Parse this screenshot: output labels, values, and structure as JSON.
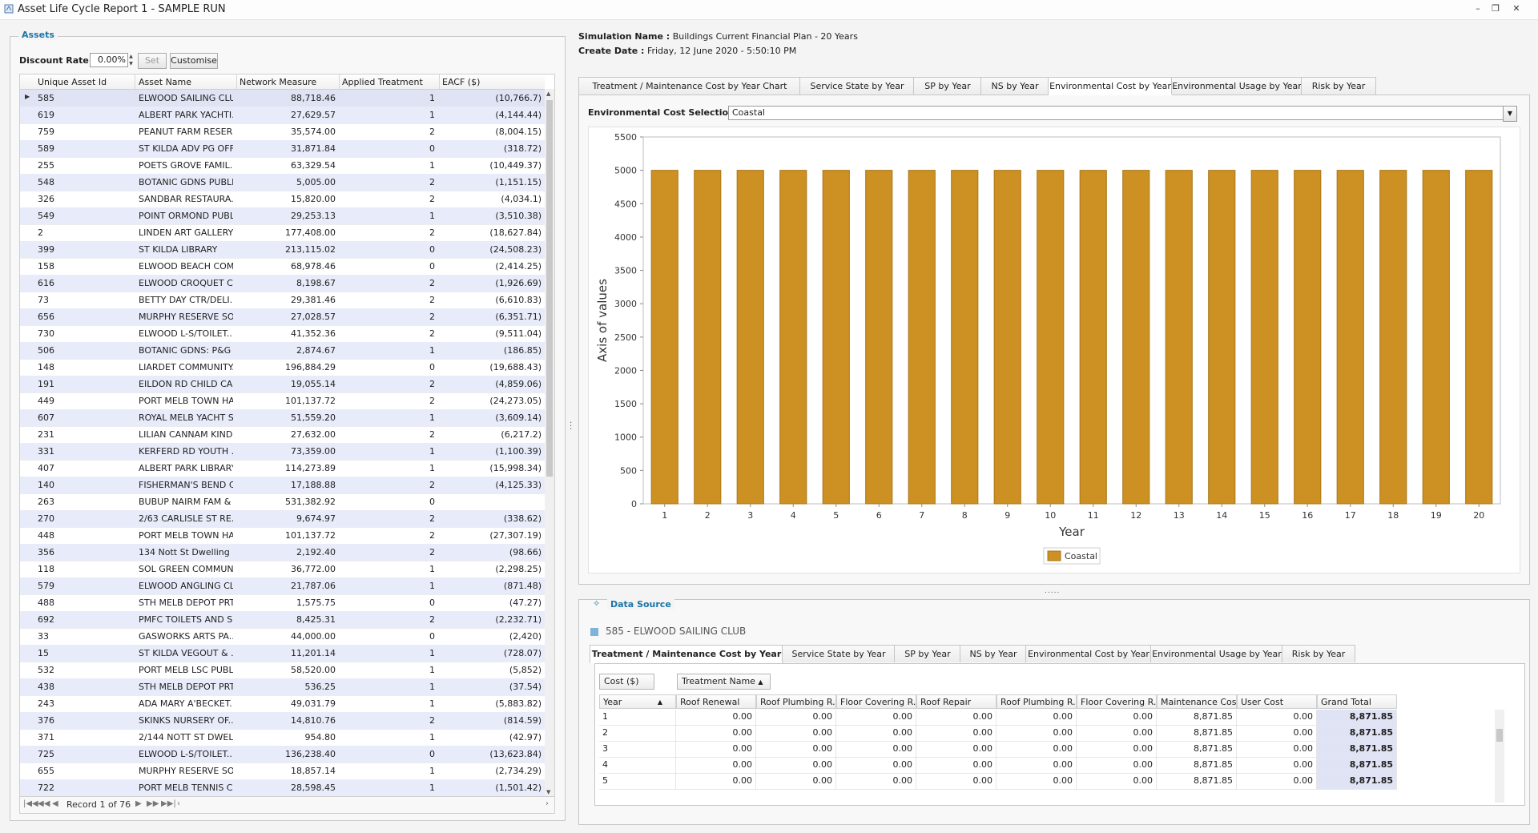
{
  "window": {
    "title": "Asset Life Cycle Report 1 - SAMPLE RUN"
  },
  "assets_panel": {
    "title": "Assets",
    "discount_label": "Discount Rate :",
    "discount_value": "0.00%",
    "set_label": "Set",
    "customise_label": "Customise",
    "columns": [
      "Unique Asset Id",
      "Asset Name",
      "Network Measure",
      "Applied Treatment",
      "EACF ($)"
    ],
    "rows": [
      [
        "585",
        "ELWOOD SAILING CLUB",
        "88,718.46",
        "1",
        "(10,766.7)"
      ],
      [
        "619",
        "ALBERT PARK YACHTI...",
        "27,629.57",
        "1",
        "(4,144.44)"
      ],
      [
        "759",
        "PEANUT FARM RESER...",
        "35,574.00",
        "2",
        "(8,004.15)"
      ],
      [
        "589",
        "ST KILDA ADV PG OFF...",
        "31,871.84",
        "0",
        "(318.72)"
      ],
      [
        "255",
        "POETS GROVE FAMIL...",
        "63,329.54",
        "1",
        "(10,449.37)"
      ],
      [
        "548",
        "BOTANIC GDNS PUBLI...",
        "5,005.00",
        "2",
        "(1,151.15)"
      ],
      [
        "326",
        "SANDBAR RESTAURA...",
        "15,820.00",
        "2",
        "(4,034.1)"
      ],
      [
        "549",
        "POINT ORMOND PUBL...",
        "29,253.13",
        "1",
        "(3,510.38)"
      ],
      [
        "2",
        "LINDEN ART GALLERY",
        "177,408.00",
        "2",
        "(18,627.84)"
      ],
      [
        "399",
        "ST KILDA LIBRARY",
        "213,115.02",
        "0",
        "(24,508.23)"
      ],
      [
        "158",
        "ELWOOD BEACH COM...",
        "68,978.46",
        "0",
        "(2,414.25)"
      ],
      [
        "616",
        "ELWOOD CROQUET C...",
        "8,198.67",
        "2",
        "(1,926.69)"
      ],
      [
        "73",
        "BETTY DAY CTR/DELI...",
        "29,381.46",
        "2",
        "(6,610.83)"
      ],
      [
        "656",
        "MURPHY RESERVE SO...",
        "27,028.57",
        "2",
        "(6,351.71)"
      ],
      [
        "730",
        "ELWOOD L-S/TOILET...",
        "41,352.36",
        "2",
        "(9,511.04)"
      ],
      [
        "506",
        "BOTANIC GDNS: P&G ...",
        "2,874.67",
        "1",
        "(186.85)"
      ],
      [
        "148",
        "LIARDET COMMUNITY...",
        "196,884.29",
        "0",
        "(19,688.43)"
      ],
      [
        "191",
        "EILDON RD CHILD CA...",
        "19,055.14",
        "2",
        "(4,859.06)"
      ],
      [
        "449",
        "PORT MELB TOWN HALL",
        "101,137.72",
        "2",
        "(24,273.05)"
      ],
      [
        "607",
        "ROYAL MELB YACHT S...",
        "51,559.20",
        "1",
        "(3,609.14)"
      ],
      [
        "231",
        "LILIAN CANNAM KIND...",
        "27,632.00",
        "2",
        "(6,217.2)"
      ],
      [
        "331",
        "KERFERD RD YOUTH ...",
        "73,359.00",
        "1",
        "(1,100.39)"
      ],
      [
        "407",
        "ALBERT PARK LIBRARY",
        "114,273.89",
        "1",
        "(15,998.34)"
      ],
      [
        "140",
        "FISHERMAN'S BEND C...",
        "17,188.88",
        "2",
        "(4,125.33)"
      ],
      [
        "263",
        "BUBUP NAIRM FAM & ...",
        "531,382.92",
        "0",
        ""
      ],
      [
        "270",
        "2/63 CARLISLE ST RE...",
        "9,674.97",
        "2",
        "(338.62)"
      ],
      [
        "448",
        "PORT MELB TOWN HALL",
        "101,137.72",
        "2",
        "(27,307.19)"
      ],
      [
        "356",
        "134 Nott St Dwelling",
        "2,192.40",
        "2",
        "(98.66)"
      ],
      [
        "118",
        "SOL GREEN COMMUN...",
        "36,772.00",
        "1",
        "(2,298.25)"
      ],
      [
        "579",
        "ELWOOD ANGLING CL...",
        "21,787.06",
        "1",
        "(871.48)"
      ],
      [
        "488",
        "STH MELB DEPOT PRT...",
        "1,575.75",
        "0",
        "(47.27)"
      ],
      [
        "692",
        "PMFC TOILETS AND S...",
        "8,425.31",
        "2",
        "(2,232.71)"
      ],
      [
        "33",
        "GASWORKS ARTS PA...",
        "44,000.00",
        "0",
        "(2,420)"
      ],
      [
        "15",
        "ST KILDA VEGOUT & ...",
        "11,201.14",
        "1",
        "(728.07)"
      ],
      [
        "532",
        "PORT MELB LSC PUBL...",
        "58,520.00",
        "1",
        "(5,852)"
      ],
      [
        "438",
        "STH MELB DEPOT PRT...",
        "536.25",
        "1",
        "(37.54)"
      ],
      [
        "243",
        "ADA MARY A'BECKET...",
        "49,031.79",
        "1",
        "(5,883.82)"
      ],
      [
        "376",
        "SKINKS NURSERY OF...",
        "14,810.76",
        "2",
        "(814.59)"
      ],
      [
        "371",
        "2/144 NOTT ST DWEL...",
        "954.80",
        "1",
        "(42.97)"
      ],
      [
        "725",
        "ELWOOD L-S/TOILET...",
        "136,238.40",
        "0",
        "(13,623.84)"
      ],
      [
        "655",
        "MURPHY RESERVE SO...",
        "18,857.14",
        "1",
        "(2,734.29)"
      ],
      [
        "722",
        "PORT MELB TENNIS C...",
        "28,598.45",
        "1",
        "(1,501.42)"
      ]
    ],
    "record_label": "Record 1 of 76"
  },
  "simulation": {
    "name_label": "Simulation Name :",
    "name_value": "Buildings Current Financial Plan - 20 Years",
    "date_label": "Create Date :",
    "date_value": "Friday, 12 June 2020 - 5:50:10 PM"
  },
  "chart_tabs": [
    "Treatment / Maintenance Cost by Year Chart",
    "Service State by Year",
    "SP by Year",
    "NS by Year",
    "Environmental Cost by Year",
    "Environmental Usage by Year",
    "Risk by Year"
  ],
  "env_selection": {
    "label": "Environmental Cost Selection :",
    "value": "Coastal"
  },
  "chart_data": {
    "type": "bar",
    "categories": [
      "1",
      "2",
      "3",
      "4",
      "5",
      "6",
      "7",
      "8",
      "9",
      "10",
      "11",
      "12",
      "13",
      "14",
      "15",
      "16",
      "17",
      "18",
      "19",
      "20"
    ],
    "series": [
      {
        "name": "Coastal",
        "values": [
          5000,
          5000,
          5000,
          5000,
          5000,
          5000,
          5000,
          5000,
          5000,
          5000,
          5000,
          5000,
          5000,
          5000,
          5000,
          5000,
          5000,
          5000,
          5000,
          5000
        ]
      }
    ],
    "xlabel": "Year",
    "ylabel": "Axis of values",
    "ylim": [
      0,
      5500
    ],
    "yticks": [
      0,
      500,
      1000,
      1500,
      2000,
      2500,
      3000,
      3500,
      4000,
      4500,
      5000,
      5500
    ],
    "legend": "bottom-center",
    "bar_color": "#cc9122"
  },
  "data_source": {
    "title": "Data Source",
    "asset": "585 - ELWOOD SAILING CLUB",
    "tabs": [
      "Treatment / Maintenance Cost by Year",
      "Service State by Year",
      "SP by Year",
      "NS by Year",
      "Environmental Cost by Year",
      "Environmental Usage by Year",
      "Risk by Year"
    ],
    "field_cost": "Cost ($)",
    "field_treatment": "Treatment Name",
    "row_header": "Year",
    "columns": [
      "Roof Renewal",
      "Roof Plumbing R...",
      "Floor Covering R...",
      "Roof Repair",
      "Roof Plumbing R...",
      "Floor Covering R...",
      "Maintenance Cost",
      "User Cost",
      "Grand Total"
    ],
    "rows": [
      {
        "year": "1",
        "values": [
          "0.00",
          "0.00",
          "0.00",
          "0.00",
          "0.00",
          "0.00",
          "8,871.85",
          "0.00",
          "8,871.85"
        ]
      },
      {
        "year": "2",
        "values": [
          "0.00",
          "0.00",
          "0.00",
          "0.00",
          "0.00",
          "0.00",
          "8,871.85",
          "0.00",
          "8,871.85"
        ]
      },
      {
        "year": "3",
        "values": [
          "0.00",
          "0.00",
          "0.00",
          "0.00",
          "0.00",
          "0.00",
          "8,871.85",
          "0.00",
          "8,871.85"
        ]
      },
      {
        "year": "4",
        "values": [
          "0.00",
          "0.00",
          "0.00",
          "0.00",
          "0.00",
          "0.00",
          "8,871.85",
          "0.00",
          "8,871.85"
        ]
      },
      {
        "year": "5",
        "values": [
          "0.00",
          "0.00",
          "0.00",
          "0.00",
          "0.00",
          "0.00",
          "8,871.85",
          "0.00",
          "8,871.85"
        ]
      }
    ]
  }
}
